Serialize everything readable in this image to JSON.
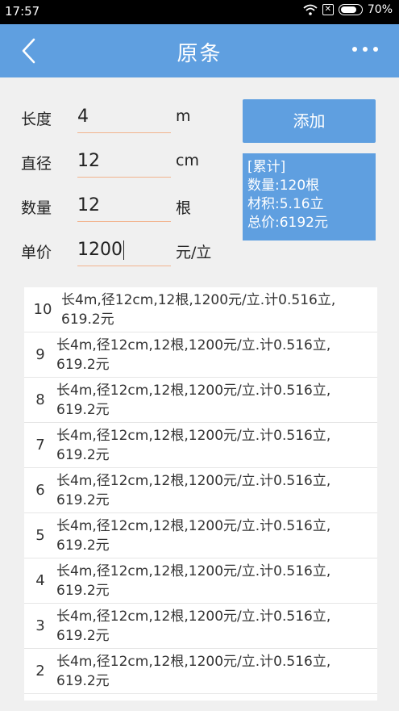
{
  "status": {
    "time": "17:57",
    "battery": "70%",
    "sim_glyph": "✕"
  },
  "app_bar": {
    "title": "原条"
  },
  "form": {
    "length": {
      "label": "长度",
      "value": "4",
      "unit": "m"
    },
    "diameter": {
      "label": "直径",
      "value": "12",
      "unit": "cm"
    },
    "count": {
      "label": "数量",
      "value": "12",
      "unit": "根"
    },
    "price": {
      "label": "单价",
      "value": "1200",
      "unit": "元/立"
    }
  },
  "add_button": {
    "label": "添加"
  },
  "summary": {
    "header": "[累计]",
    "quantity": "数量:120根",
    "volume": "材积:5.16立",
    "total": "总价:6192元"
  },
  "records": [
    {
      "index": "10",
      "text": "长4m,径12cm,12根,1200元/立.计0.516立, 619.2元"
    },
    {
      "index": "9",
      "text": "长4m,径12cm,12根,1200元/立.计0.516立, 619.2元"
    },
    {
      "index": "8",
      "text": "长4m,径12cm,12根,1200元/立.计0.516立, 619.2元"
    },
    {
      "index": "7",
      "text": "长4m,径12cm,12根,1200元/立.计0.516立, 619.2元"
    },
    {
      "index": "6",
      "text": "长4m,径12cm,12根,1200元/立.计0.516立, 619.2元"
    },
    {
      "index": "5",
      "text": "长4m,径12cm,12根,1200元/立.计0.516立, 619.2元"
    },
    {
      "index": "4",
      "text": "长4m,径12cm,12根,1200元/立.计0.516立, 619.2元"
    },
    {
      "index": "3",
      "text": "长4m,径12cm,12根,1200元/立.计0.516立, 619.2元"
    },
    {
      "index": "2",
      "text": "长4m,径12cm,12根,1200元/立.计0.516立, 619.2元"
    }
  ]
}
